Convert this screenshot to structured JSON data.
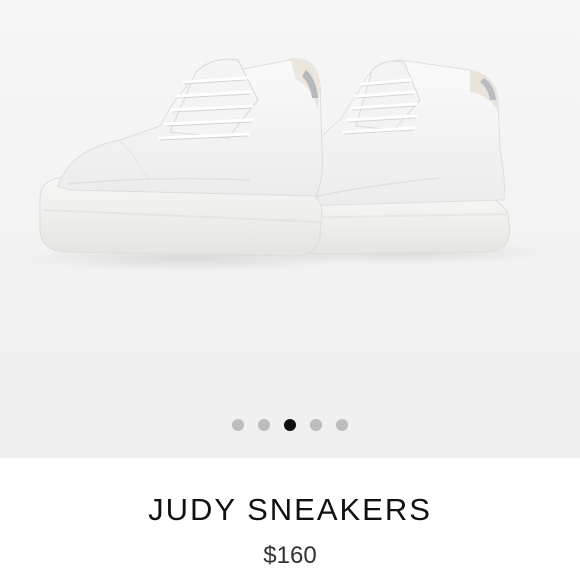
{
  "product": {
    "name": "JUDY SNEAKERS",
    "price": "$160",
    "image_alt": "white leather platform sneakers"
  },
  "gallery": {
    "slide_count": 5,
    "active_index": 2
  },
  "colors": {
    "dot_inactive": "#bdbdbd",
    "dot_active": "#111111",
    "background": "#f2f2f2"
  }
}
